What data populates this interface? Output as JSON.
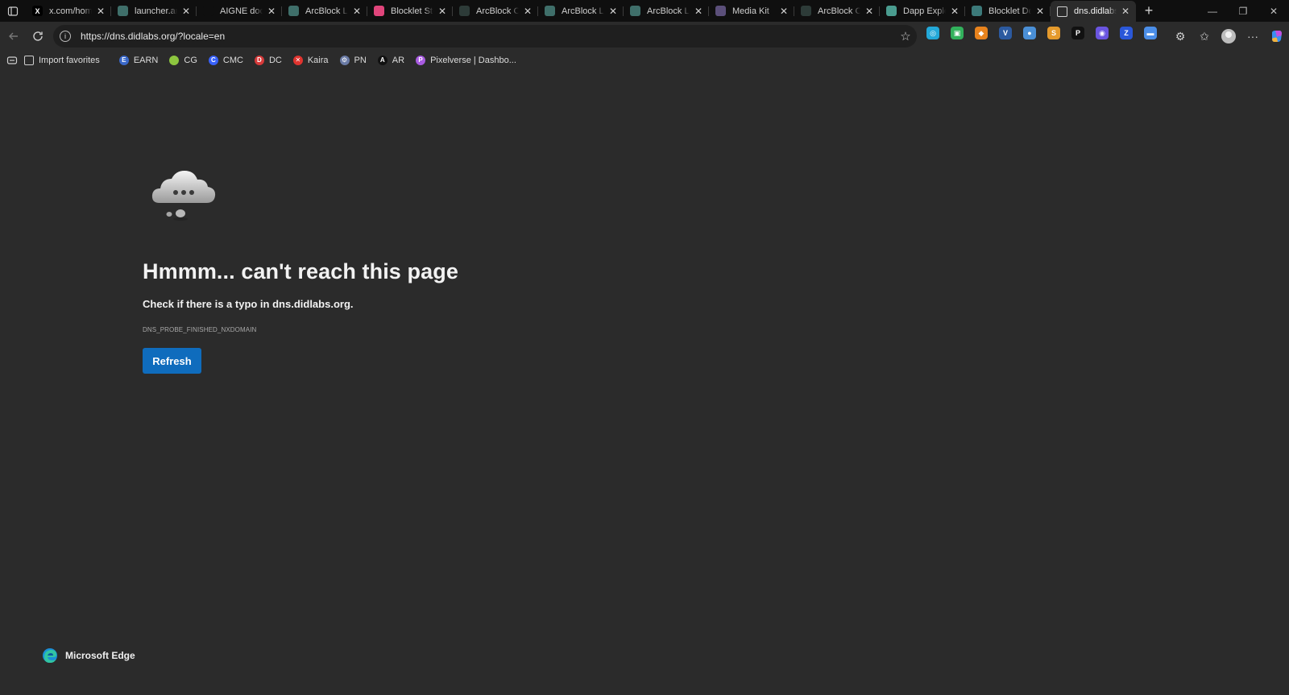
{
  "browser": {
    "tabs": [
      {
        "title": "x.com/home",
        "icon": "x-logo",
        "icon_color": "#000000",
        "glyph": "X"
      },
      {
        "title": "launcher.arc",
        "icon": "arcblock-favicon",
        "icon_color": "#3f6f6a",
        "glyph": ""
      },
      {
        "title": "AIGNE docs",
        "icon": "github-icon",
        "icon_color": "#0f0f0f",
        "glyph": ""
      },
      {
        "title": "ArcBlock Launcher",
        "icon": "arcblock-favicon",
        "icon_color": "#3f6f6a",
        "glyph": ""
      },
      {
        "title": "Blocklet Store",
        "icon": "blocklet-store-favicon",
        "icon_color": "#e0457b",
        "glyph": ""
      },
      {
        "title": "ArcBlock Community",
        "icon": "arcblock-community-favicon",
        "icon_color": "#2d3b38",
        "glyph": ""
      },
      {
        "title": "ArcBlock Launcher",
        "icon": "arcblock-favicon",
        "icon_color": "#3f6f6a",
        "glyph": ""
      },
      {
        "title": "ArcBlock Launcher",
        "icon": "arcblock-favicon",
        "icon_color": "#3f6f6a",
        "glyph": ""
      },
      {
        "title": "Media Kit",
        "icon": "media-kit-favicon",
        "icon_color": "#5b4f7a",
        "glyph": ""
      },
      {
        "title": "ArcBlock Community",
        "icon": "arcblock-community-favicon",
        "icon_color": "#2d3b38",
        "glyph": ""
      },
      {
        "title": "Dapp Explorer",
        "icon": "dapp-explorer-favicon",
        "icon_color": "#4a9c8f",
        "glyph": ""
      },
      {
        "title": "Blocklet Dev",
        "icon": "globe-icon",
        "icon_color": "#3c7a7a",
        "glyph": ""
      },
      {
        "title": "dns.didlabs.org",
        "icon": "page-icon",
        "icon_color": "#2b2b2b",
        "glyph": ""
      }
    ],
    "active_tab_index": 12,
    "address": {
      "url": "https://dns.didlabs.org/?locale=en"
    },
    "extensions": [
      {
        "name": "ext-1-icon",
        "color": "#23a8d8",
        "glyph": "◎"
      },
      {
        "name": "ext-2-icon",
        "color": "#32b15c",
        "glyph": "▣"
      },
      {
        "name": "metamask-icon",
        "color": "#e8831d",
        "glyph": "◆"
      },
      {
        "name": "v-ext-icon",
        "color": "#2c5aa0",
        "glyph": "V"
      },
      {
        "name": "globe-ext-icon",
        "color": "#4a8fd6",
        "glyph": "●"
      },
      {
        "name": "s-ext-icon",
        "color": "#e59a2c",
        "glyph": "S"
      },
      {
        "name": "p-ext-icon",
        "color": "#111111",
        "glyph": "P"
      },
      {
        "name": "phantom-icon",
        "color": "#6a55e0",
        "glyph": "◉"
      },
      {
        "name": "z-ext-icon",
        "color": "#2a57d8",
        "glyph": "Z"
      },
      {
        "name": "wallet-ext-icon",
        "color": "#4b8ee8",
        "glyph": "▬"
      }
    ],
    "favorites": [
      {
        "label": "Import favorites",
        "icon": "import-icon",
        "color": "transparent",
        "glyph": ""
      },
      {
        "label": "EARN",
        "icon": "earn-icon",
        "color": "#3a68c9",
        "glyph": "E"
      },
      {
        "label": "CG",
        "icon": "coingecko-icon",
        "color": "#8dc63f",
        "glyph": ""
      },
      {
        "label": "CMC",
        "icon": "coinmarketcap-icon",
        "color": "#3861fb",
        "glyph": "C"
      },
      {
        "label": "DC",
        "icon": "dc-icon",
        "color": "#d63a3a",
        "glyph": "D"
      },
      {
        "label": "Kaira",
        "icon": "kaira-icon",
        "color": "#e0342f",
        "glyph": "✕"
      },
      {
        "label": "PN",
        "icon": "pn-icon",
        "color": "#6a7ba6",
        "glyph": "⚙"
      },
      {
        "label": "AR",
        "icon": "ar-icon",
        "color": "#111111",
        "glyph": "A"
      },
      {
        "label": "Pixelverse | Dashbo...",
        "icon": "pixelverse-icon",
        "color": "#a85be0",
        "glyph": "P"
      }
    ]
  },
  "page": {
    "title": "Hmmm... can't reach this page",
    "subtitle": "Check if there is a typo in dns.didlabs.org.",
    "error_code": "DNS_PROBE_FINISHED_NXDOMAIN",
    "refresh_label": "Refresh",
    "brand_name": "Microsoft Edge"
  }
}
